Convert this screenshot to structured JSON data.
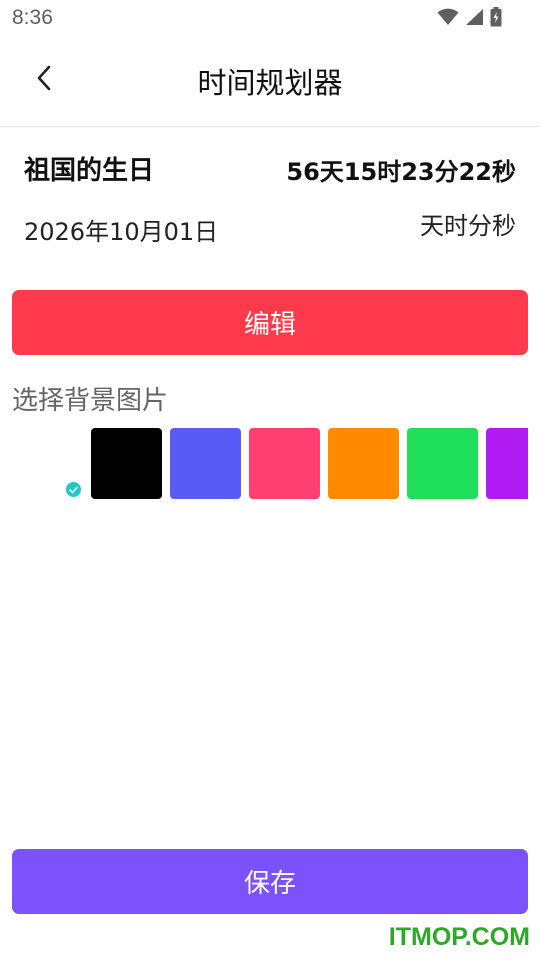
{
  "status_bar": {
    "time": "8:36",
    "icons": [
      "wifi-icon",
      "cell-signal-icon",
      "battery-charging-icon"
    ],
    "icon_color": "#5f5f5f"
  },
  "app_bar": {
    "title": "时间规划器",
    "back_icon": "back-chevron-icon"
  },
  "event": {
    "name": "祖国的生日",
    "countdown": "56天15时23分22秒",
    "date": "2026年10月01日",
    "unit_label": "天时分秒"
  },
  "edit_button": {
    "label": "编辑",
    "color": "#ff3a4c"
  },
  "background_picker": {
    "label": "选择背景图片",
    "selected_check_color": "#1dc8c8",
    "swatches": [
      {
        "name": "transparent",
        "color": "#ffffff",
        "selected": true
      },
      {
        "name": "black",
        "color": "#000000",
        "selected": false
      },
      {
        "name": "blue",
        "color": "#5a5af5",
        "selected": false
      },
      {
        "name": "pink",
        "color": "#ff3f72",
        "selected": false
      },
      {
        "name": "orange",
        "color": "#ff8a00",
        "selected": false
      },
      {
        "name": "green",
        "color": "#1fe05a",
        "selected": false
      },
      {
        "name": "purple",
        "color": "#b21cf4",
        "selected": false
      }
    ]
  },
  "save_button": {
    "label": "保存",
    "color": "#7b52fb"
  },
  "watermark": {
    "text": "ITMOP.COM"
  }
}
